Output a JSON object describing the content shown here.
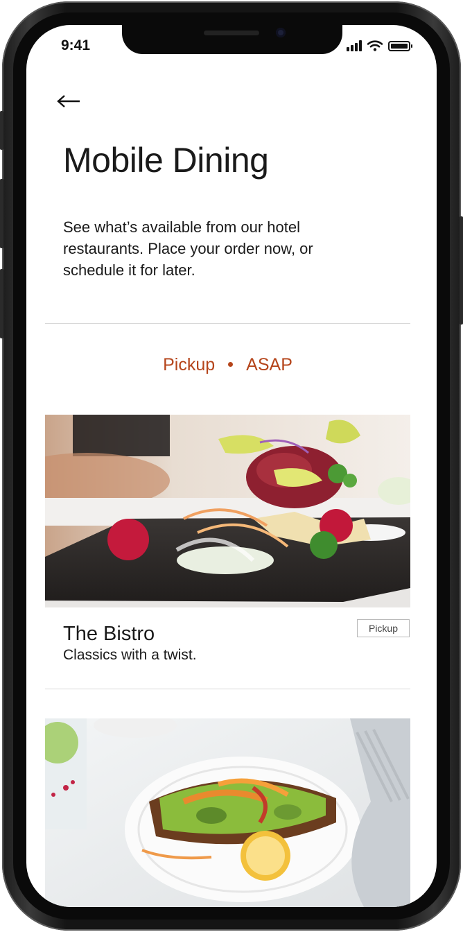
{
  "status_bar": {
    "time": "9:41"
  },
  "header": {
    "back_icon": "arrow-left-icon",
    "title": "Mobile Dining",
    "description": "See what’s available from our hotel restaurants. Place your order now, or schedule it for later."
  },
  "order_mode": {
    "method": "Pickup",
    "timing": "ASAP",
    "accent_color": "#b5451b"
  },
  "restaurants": [
    {
      "name": "The Bistro",
      "tagline": "Classics with a twist.",
      "badge": "Pickup"
    }
  ]
}
